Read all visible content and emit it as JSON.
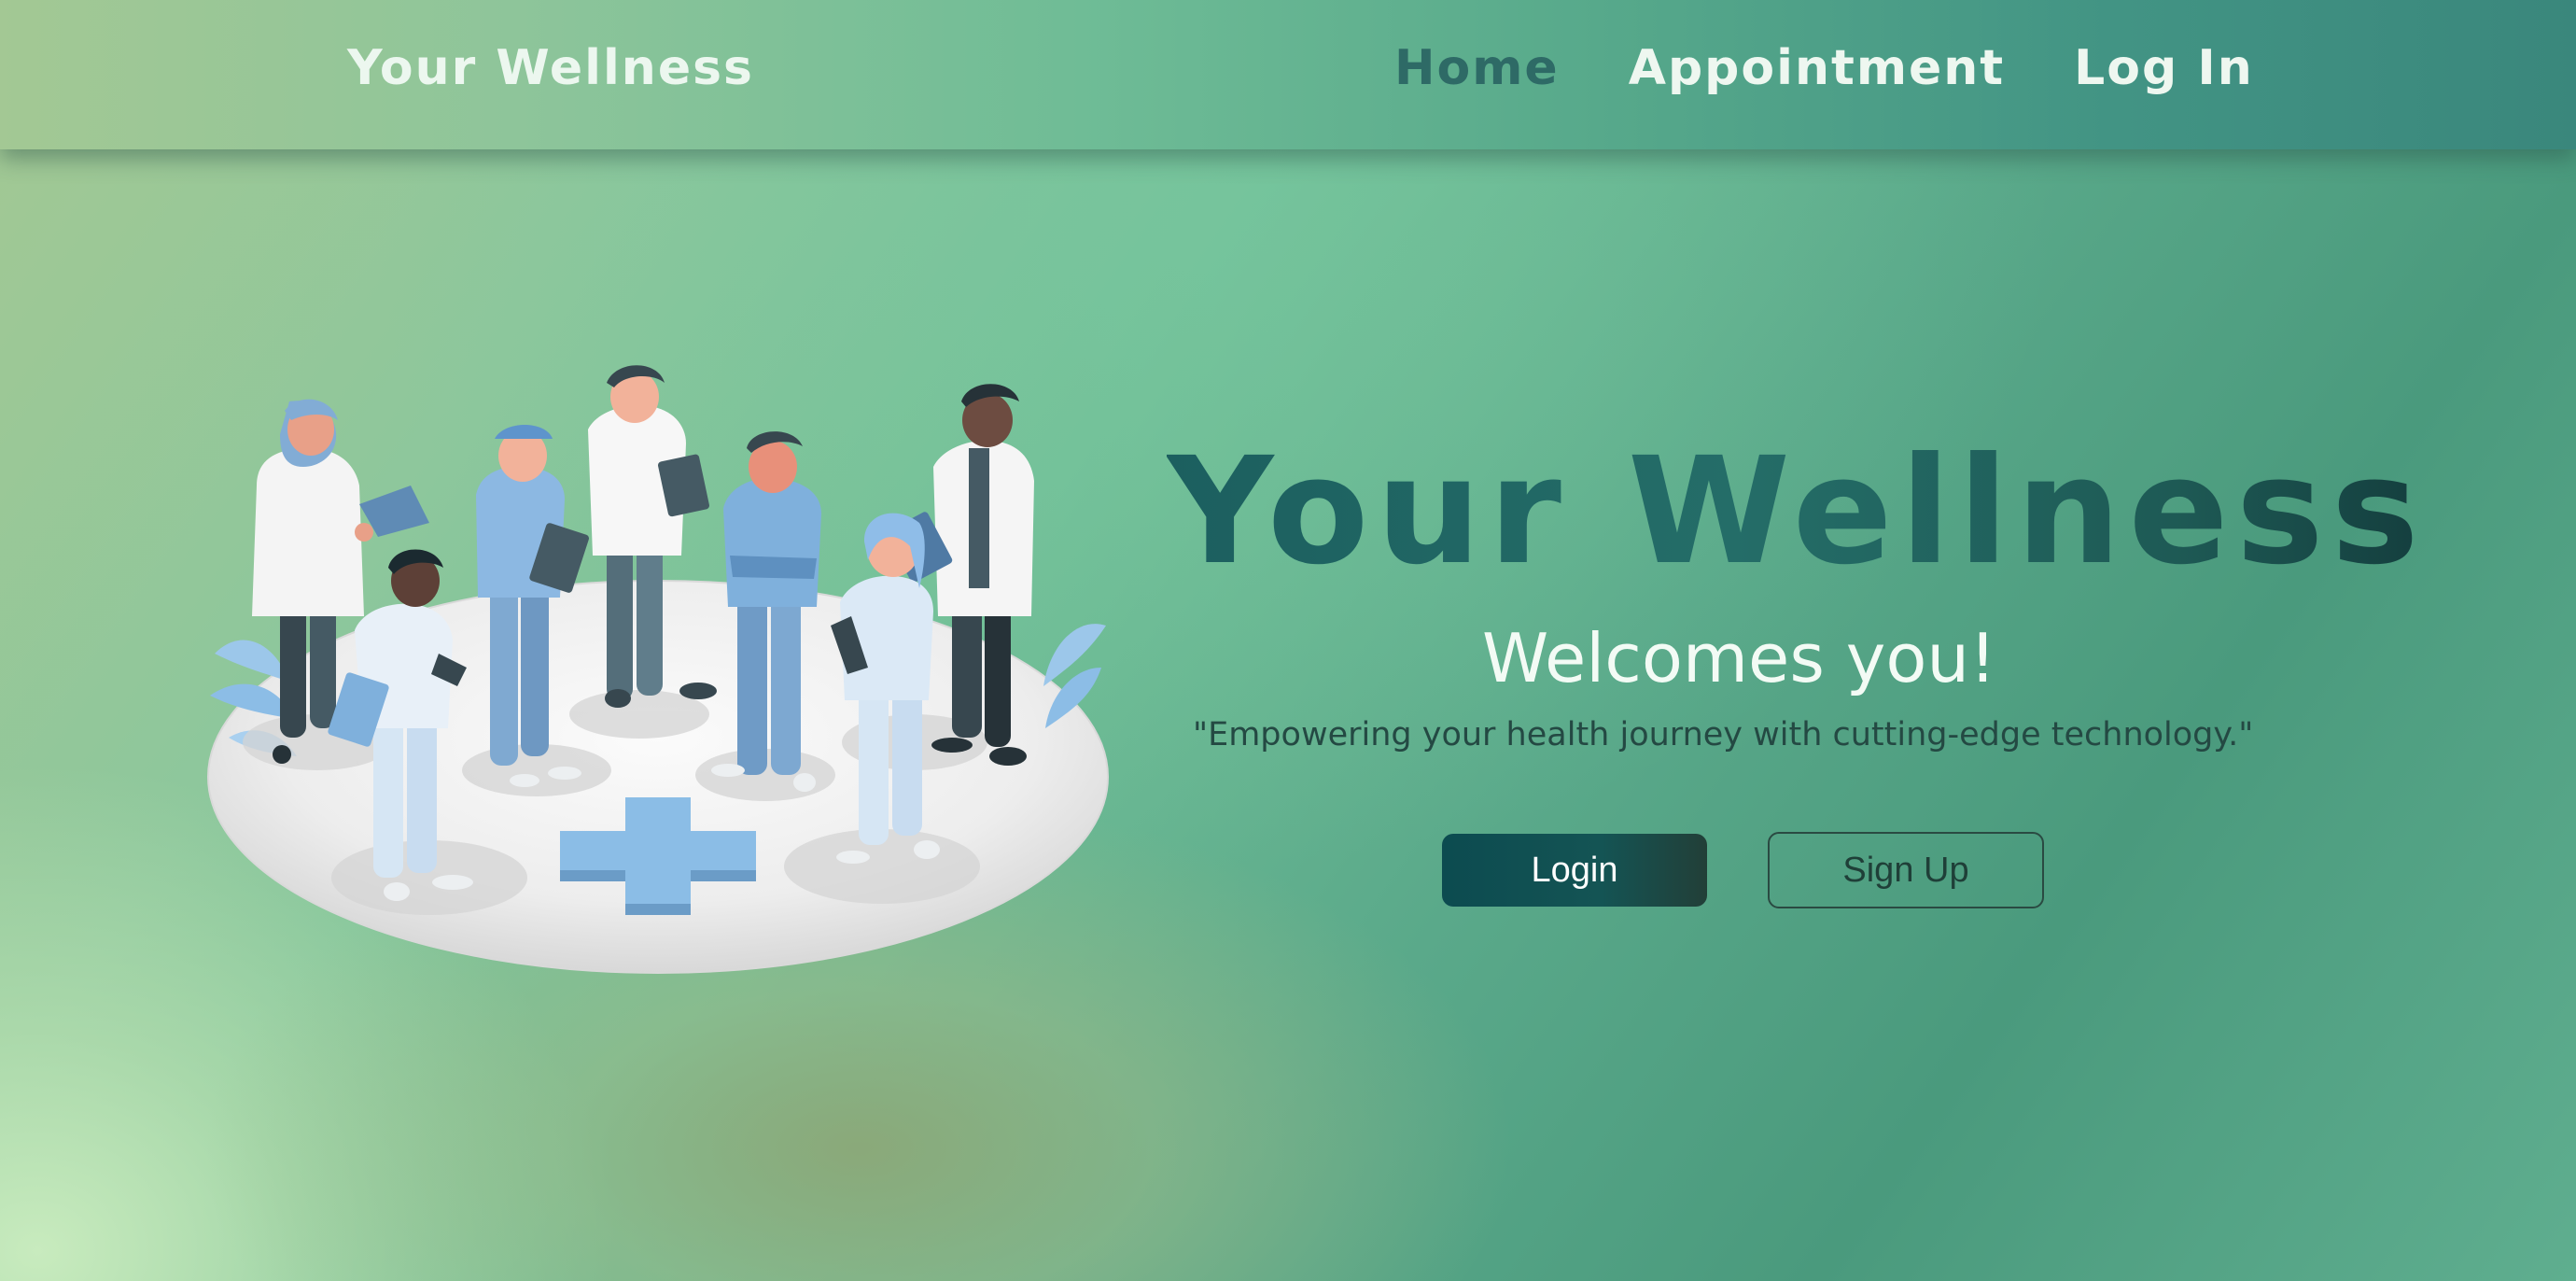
{
  "header": {
    "brand": "Your Wellness",
    "nav": [
      {
        "label": "Home",
        "active": true
      },
      {
        "label": "Appointment",
        "active": false
      },
      {
        "label": "Log In",
        "active": false
      }
    ]
  },
  "hero": {
    "title": "Your Wellness",
    "subtitle": "Welcomes you!",
    "tagline": "\"Empowering your health journey with cutting-edge technology.\"",
    "login_label": "Login",
    "signup_label": "Sign Up"
  },
  "illustration": {
    "icon": "medical-team-illustration"
  },
  "colors": {
    "accent_dark": "#0c4b50",
    "title_teal": "#1c5f5f",
    "nav_active": "#2e6a66",
    "cross_blue": "#8bbde6"
  }
}
